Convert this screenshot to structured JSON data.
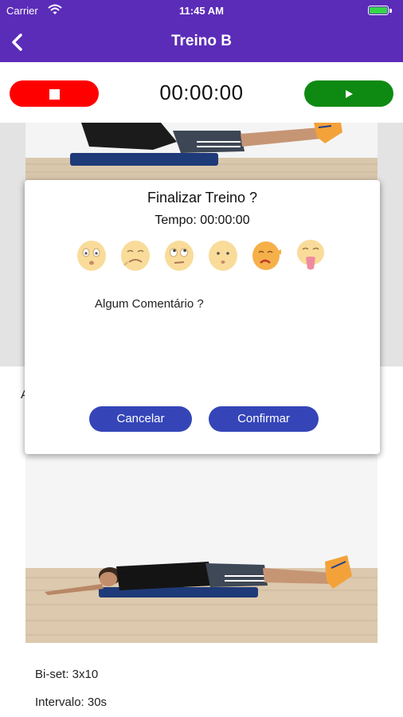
{
  "status_bar": {
    "carrier": "Carrier",
    "time": "11:45 AM",
    "wifi_icon": "wifi-icon",
    "battery_icon": "battery-icon",
    "battery_level": 1.0,
    "battery_color": "#35d64a"
  },
  "nav": {
    "title": "Treino B",
    "back_icon": "chevron-left-icon",
    "color": "#5b2cb8"
  },
  "timer": {
    "value": "00:00:00",
    "stop_icon": "stop-icon",
    "play_icon": "play-icon",
    "stop_color": "#ff0000",
    "play_color": "#0e8a12"
  },
  "background_partial_text": "A",
  "exercise": {
    "info_line_1": "Bi-set: 3x10",
    "info_line_2": "Intervalo: 30s"
  },
  "modal": {
    "title": "Finalizar Treino ?",
    "time_label": "Tempo: 00:00:00",
    "emojis": [
      "sleepy-face-icon",
      "dizzy-face-icon",
      "rolling-eyes-face-icon",
      "worried-face-icon",
      "sad-pointing-face-icon",
      "vomiting-face-icon"
    ],
    "comment_placeholder": "Algum Comentário ?",
    "cancel_label": "Cancelar",
    "confirm_label": "Confirmar",
    "button_color": "#3545b8"
  }
}
